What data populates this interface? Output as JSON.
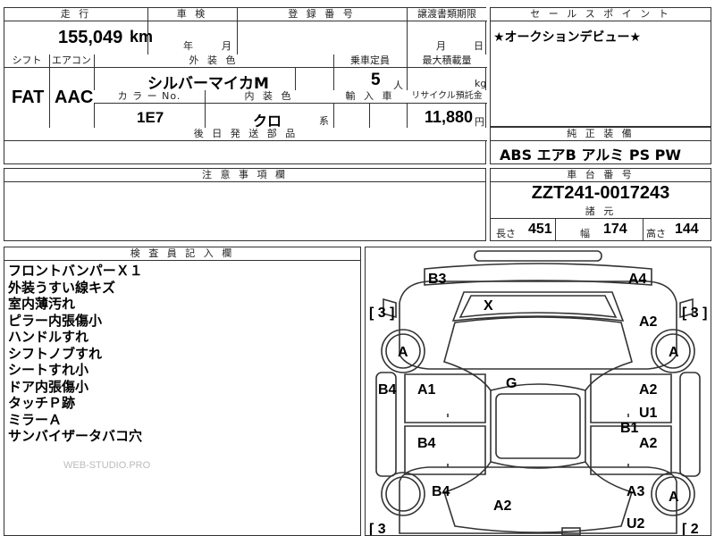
{
  "top": {
    "mileage_label": "走 行",
    "mileage_value": "155,049",
    "mileage_unit": "km",
    "inspection_label": "車 検",
    "inspection_year": "年",
    "inspection_month": "月",
    "regno_label": "登 録 番 号",
    "transfer_label": "譲渡書類期限",
    "transfer_month": "月",
    "transfer_day": "日",
    "shift_label": "シフト",
    "shift_value": "FAT",
    "aircon_label": "エアコン",
    "aircon_value": "AAC",
    "color_label": "外 装 色",
    "color_value": "シルバーマイカM",
    "capacity_label": "乗車定員",
    "capacity_value": "5",
    "capacity_unit": "人",
    "load_label": "最大積載量",
    "load_unit": "kg",
    "colorno_label": "カ ラ ー No.",
    "colorno_value": "1E7",
    "interior_label": "内 装 色",
    "interior_value": "クロ",
    "interior_suffix": "系",
    "import_label": "輸 入 車",
    "recycle_label": "リサイクル預託金",
    "recycle_value": "11,880",
    "recycle_unit": "円",
    "later_parts_label": "後 日 発 送 部 品"
  },
  "sales": {
    "label": "セ ー ル ス ポ イ ン ト",
    "text": "★オークションデビュー★"
  },
  "equipment": {
    "label": "純 正 装 備",
    "value": "ABS エアB アルミ PS PW"
  },
  "notes": {
    "label": "注 意 事 項 欄"
  },
  "chassis": {
    "label": "車 台 番 号",
    "value": "ZZT241-0017243",
    "spec_label": "諸 元",
    "length_label": "長さ",
    "length_value": "451",
    "width_label": "幅",
    "width_value": "174",
    "height_label": "高さ",
    "height_value": "144"
  },
  "inspector": {
    "label": "検 査 員 記 入 欄",
    "lines": [
      "フロントバンパーＸ１",
      "外装うすい線キズ",
      "室内薄汚れ",
      "ピラー内張傷小",
      "ハンドルすれ",
      "シフトノブすれ",
      "シートすれ小",
      "ドア内張傷小",
      "タッチＰ跡",
      "ミラーＡ",
      "サンバイザータバコ穴"
    ],
    "watermark": "WEB-STUDIO.PRO"
  },
  "diagram": {
    "marks": {
      "b3": "B3",
      "a4": "A4",
      "x": "X",
      "tire_fl": "[ 3 ]",
      "tire_fr": "[ 3 ]",
      "tire_rl": "[ 3",
      "tire_rr": "[ 2",
      "a_fl": "A",
      "a_fr": "A",
      "a_rr": "A",
      "a2_front_right": "A2",
      "g": "G",
      "b4_side": "B4",
      "a1": "A1",
      "a2_door_fr": "A2",
      "u1": "U1",
      "b1": "B1",
      "b4_door_rl": "B4",
      "a2_door_rr": "A2",
      "b4_rear_left": "B4",
      "a3": "A3",
      "a2_rear": "A2",
      "u2": "U2"
    }
  }
}
